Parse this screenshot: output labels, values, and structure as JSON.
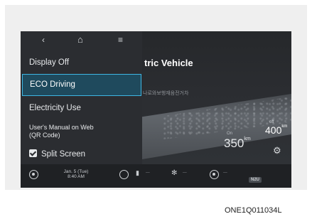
{
  "top_bar": {
    "back_icon": "‹",
    "home_icon": "⌂",
    "menu_icon": "≡"
  },
  "menu": {
    "items": [
      {
        "label": "Display Off"
      },
      {
        "label": "ECO Driving"
      },
      {
        "label": "Electricity Use"
      },
      {
        "label_line1": "User's Manual on Web",
        "label_line2": "(QR Code)"
      },
      {
        "label": "Split Screen"
      }
    ]
  },
  "vehicle_panel": {
    "title": "tric Vehicle",
    "subtitle": "나로와보행재음전거차",
    "range_main_label": "On",
    "range_main_value": "350",
    "range_main_unit": "km",
    "range_alt_label": "off",
    "range_alt_value": "400",
    "range_alt_unit": "km"
  },
  "status_bar": {
    "date": "Jan. 5 (Tue)",
    "time": "8:40  AM",
    "badge": "N2U"
  },
  "caption": "ONE1Q011034L",
  "colors": {
    "selected_fill": "#1f4a5d",
    "selected_border": "#3db6e3"
  }
}
